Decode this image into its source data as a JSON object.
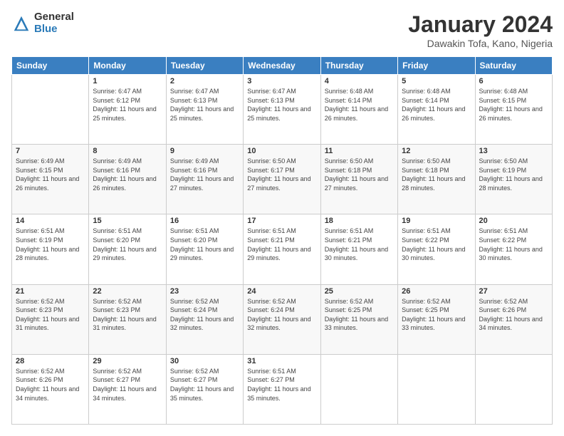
{
  "logo": {
    "general": "General",
    "blue": "Blue"
  },
  "header": {
    "title": "January 2024",
    "subtitle": "Dawakin Tofa, Kano, Nigeria"
  },
  "weekdays": [
    "Sunday",
    "Monday",
    "Tuesday",
    "Wednesday",
    "Thursday",
    "Friday",
    "Saturday"
  ],
  "weeks": [
    [
      {
        "day": "",
        "sunrise": "",
        "sunset": "",
        "daylight": ""
      },
      {
        "day": "1",
        "sunrise": "Sunrise: 6:47 AM",
        "sunset": "Sunset: 6:12 PM",
        "daylight": "Daylight: 11 hours and 25 minutes."
      },
      {
        "day": "2",
        "sunrise": "Sunrise: 6:47 AM",
        "sunset": "Sunset: 6:13 PM",
        "daylight": "Daylight: 11 hours and 25 minutes."
      },
      {
        "day": "3",
        "sunrise": "Sunrise: 6:47 AM",
        "sunset": "Sunset: 6:13 PM",
        "daylight": "Daylight: 11 hours and 25 minutes."
      },
      {
        "day": "4",
        "sunrise": "Sunrise: 6:48 AM",
        "sunset": "Sunset: 6:14 PM",
        "daylight": "Daylight: 11 hours and 26 minutes."
      },
      {
        "day": "5",
        "sunrise": "Sunrise: 6:48 AM",
        "sunset": "Sunset: 6:14 PM",
        "daylight": "Daylight: 11 hours and 26 minutes."
      },
      {
        "day": "6",
        "sunrise": "Sunrise: 6:48 AM",
        "sunset": "Sunset: 6:15 PM",
        "daylight": "Daylight: 11 hours and 26 minutes."
      }
    ],
    [
      {
        "day": "7",
        "sunrise": "Sunrise: 6:49 AM",
        "sunset": "Sunset: 6:15 PM",
        "daylight": "Daylight: 11 hours and 26 minutes."
      },
      {
        "day": "8",
        "sunrise": "Sunrise: 6:49 AM",
        "sunset": "Sunset: 6:16 PM",
        "daylight": "Daylight: 11 hours and 26 minutes."
      },
      {
        "day": "9",
        "sunrise": "Sunrise: 6:49 AM",
        "sunset": "Sunset: 6:16 PM",
        "daylight": "Daylight: 11 hours and 27 minutes."
      },
      {
        "day": "10",
        "sunrise": "Sunrise: 6:50 AM",
        "sunset": "Sunset: 6:17 PM",
        "daylight": "Daylight: 11 hours and 27 minutes."
      },
      {
        "day": "11",
        "sunrise": "Sunrise: 6:50 AM",
        "sunset": "Sunset: 6:18 PM",
        "daylight": "Daylight: 11 hours and 27 minutes."
      },
      {
        "day": "12",
        "sunrise": "Sunrise: 6:50 AM",
        "sunset": "Sunset: 6:18 PM",
        "daylight": "Daylight: 11 hours and 28 minutes."
      },
      {
        "day": "13",
        "sunrise": "Sunrise: 6:50 AM",
        "sunset": "Sunset: 6:19 PM",
        "daylight": "Daylight: 11 hours and 28 minutes."
      }
    ],
    [
      {
        "day": "14",
        "sunrise": "Sunrise: 6:51 AM",
        "sunset": "Sunset: 6:19 PM",
        "daylight": "Daylight: 11 hours and 28 minutes."
      },
      {
        "day": "15",
        "sunrise": "Sunrise: 6:51 AM",
        "sunset": "Sunset: 6:20 PM",
        "daylight": "Daylight: 11 hours and 29 minutes."
      },
      {
        "day": "16",
        "sunrise": "Sunrise: 6:51 AM",
        "sunset": "Sunset: 6:20 PM",
        "daylight": "Daylight: 11 hours and 29 minutes."
      },
      {
        "day": "17",
        "sunrise": "Sunrise: 6:51 AM",
        "sunset": "Sunset: 6:21 PM",
        "daylight": "Daylight: 11 hours and 29 minutes."
      },
      {
        "day": "18",
        "sunrise": "Sunrise: 6:51 AM",
        "sunset": "Sunset: 6:21 PM",
        "daylight": "Daylight: 11 hours and 30 minutes."
      },
      {
        "day": "19",
        "sunrise": "Sunrise: 6:51 AM",
        "sunset": "Sunset: 6:22 PM",
        "daylight": "Daylight: 11 hours and 30 minutes."
      },
      {
        "day": "20",
        "sunrise": "Sunrise: 6:51 AM",
        "sunset": "Sunset: 6:22 PM",
        "daylight": "Daylight: 11 hours and 30 minutes."
      }
    ],
    [
      {
        "day": "21",
        "sunrise": "Sunrise: 6:52 AM",
        "sunset": "Sunset: 6:23 PM",
        "daylight": "Daylight: 11 hours and 31 minutes."
      },
      {
        "day": "22",
        "sunrise": "Sunrise: 6:52 AM",
        "sunset": "Sunset: 6:23 PM",
        "daylight": "Daylight: 11 hours and 31 minutes."
      },
      {
        "day": "23",
        "sunrise": "Sunrise: 6:52 AM",
        "sunset": "Sunset: 6:24 PM",
        "daylight": "Daylight: 11 hours and 32 minutes."
      },
      {
        "day": "24",
        "sunrise": "Sunrise: 6:52 AM",
        "sunset": "Sunset: 6:24 PM",
        "daylight": "Daylight: 11 hours and 32 minutes."
      },
      {
        "day": "25",
        "sunrise": "Sunrise: 6:52 AM",
        "sunset": "Sunset: 6:25 PM",
        "daylight": "Daylight: 11 hours and 33 minutes."
      },
      {
        "day": "26",
        "sunrise": "Sunrise: 6:52 AM",
        "sunset": "Sunset: 6:25 PM",
        "daylight": "Daylight: 11 hours and 33 minutes."
      },
      {
        "day": "27",
        "sunrise": "Sunrise: 6:52 AM",
        "sunset": "Sunset: 6:26 PM",
        "daylight": "Daylight: 11 hours and 34 minutes."
      }
    ],
    [
      {
        "day": "28",
        "sunrise": "Sunrise: 6:52 AM",
        "sunset": "Sunset: 6:26 PM",
        "daylight": "Daylight: 11 hours and 34 minutes."
      },
      {
        "day": "29",
        "sunrise": "Sunrise: 6:52 AM",
        "sunset": "Sunset: 6:27 PM",
        "daylight": "Daylight: 11 hours and 34 minutes."
      },
      {
        "day": "30",
        "sunrise": "Sunrise: 6:52 AM",
        "sunset": "Sunset: 6:27 PM",
        "daylight": "Daylight: 11 hours and 35 minutes."
      },
      {
        "day": "31",
        "sunrise": "Sunrise: 6:51 AM",
        "sunset": "Sunset: 6:27 PM",
        "daylight": "Daylight: 11 hours and 35 minutes."
      },
      {
        "day": "",
        "sunrise": "",
        "sunset": "",
        "daylight": ""
      },
      {
        "day": "",
        "sunrise": "",
        "sunset": "",
        "daylight": ""
      },
      {
        "day": "",
        "sunrise": "",
        "sunset": "",
        "daylight": ""
      }
    ]
  ]
}
